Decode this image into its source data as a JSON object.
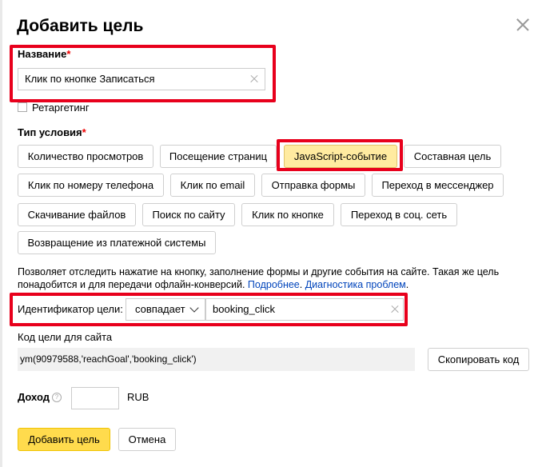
{
  "dialog": {
    "title": "Добавить цель"
  },
  "name_field": {
    "label": "Название",
    "required_mark": "*",
    "value": "Клик по кнопке Записаться"
  },
  "retargeting": {
    "label": "Ретаргетинг",
    "checked": false
  },
  "condition_type": {
    "label": "Тип условия",
    "required_mark": "*",
    "options": [
      "Количество просмотров",
      "Посещение страниц",
      "JavaScript-событие",
      "Составная цель",
      "Клик по номеру телефона",
      "Клик по email",
      "Отправка формы",
      "Переход в мессенджер",
      "Скачивание файлов",
      "Поиск по сайту",
      "Клик по кнопке",
      "Переход в соц. сеть",
      "Возвращение из платежной системы"
    ],
    "selected": "JavaScript-событие"
  },
  "description": {
    "text": "Позволяет отследить нажатие на кнопку, заполнение формы и другие события на сайте. Такая же цель понадобится и для передачи офлайн-конверсий.",
    "link_more": "Подробнее",
    "link_diagnostics": "Диагностика проблем",
    "end": "."
  },
  "goal_id": {
    "label": "Идентификатор цели:",
    "match_value": "совпадает",
    "value": "booking_click"
  },
  "site_code": {
    "label": "Код цели для сайта",
    "code": "ym(90979588,'reachGoal','booking_click')",
    "copy_button": "Скопировать код"
  },
  "income": {
    "label": "Доход",
    "help_icon": "?",
    "value": "",
    "currency": "RUB"
  },
  "actions": {
    "submit": "Добавить цель",
    "cancel": "Отмена"
  },
  "colors": {
    "highlight": "#e8001c",
    "selected_option": "#ffeba0",
    "primary_button": "#ffdb4d",
    "link": "#0044bb"
  },
  "icons": {
    "close": "close-icon",
    "clear": "clear-icon",
    "dropdown": "chevron-down-icon",
    "help": "question-icon"
  }
}
